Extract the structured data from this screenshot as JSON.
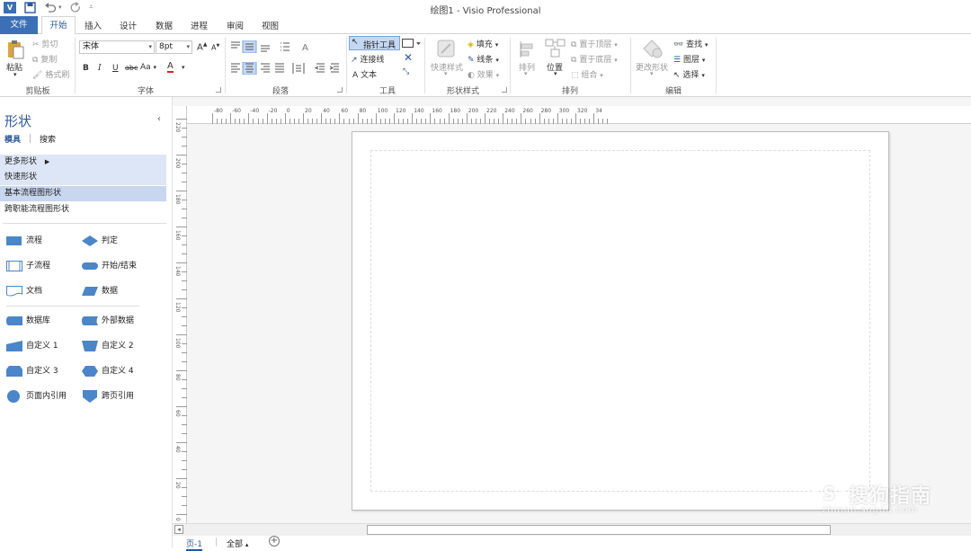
{
  "window": {
    "title": "绘图1 - Visio Professional"
  },
  "qat": {
    "app_icon": "visio-icon",
    "save": "save-icon",
    "undo": "undo-icon",
    "redo": "redo-icon"
  },
  "tabs": {
    "file": "文件",
    "home": "开始",
    "insert": "插入",
    "design": "设计",
    "data": "数据",
    "process": "进程",
    "review": "审阅",
    "view": "视图"
  },
  "ribbon": {
    "clipboard": {
      "label": "剪贴板",
      "paste": "粘贴",
      "cut": "剪切",
      "copy": "复制",
      "format_painter": "格式刷"
    },
    "font": {
      "label": "字体",
      "font_name": "宋体",
      "font_size": "8pt",
      "bold": "B",
      "italic": "I",
      "underline": "U",
      "strike": "abc",
      "case": "Aa",
      "color": "A",
      "grow": "A",
      "shrink": "A"
    },
    "paragraph": {
      "label": "段落"
    },
    "tools": {
      "label": "工具",
      "pointer": "指针工具",
      "connector": "连接线",
      "text": "文本"
    },
    "shape_styles": {
      "label": "形状样式",
      "quick_styles": "快速样式",
      "fill": "填充",
      "line": "线条",
      "effects": "效果"
    },
    "arrange": {
      "label": "排列",
      "align": "排列",
      "position": "位置",
      "bring_front": "置于顶层",
      "send_back": "置于底层",
      "group": "组合"
    },
    "editing": {
      "label": "编辑",
      "change_shape": "更改形状",
      "find": "查找",
      "layers": "图层",
      "select": "选择"
    }
  },
  "panel": {
    "title": "形状",
    "tab_stencils": "模具",
    "tab_search": "搜索",
    "categories": [
      "更多形状",
      "快速形状",
      "基本流程图形状",
      "跨职能流程图形状"
    ],
    "shapes": [
      {
        "label": "流程",
        "icon": "process-shape-icon"
      },
      {
        "label": "判定",
        "icon": "decision-shape-icon"
      },
      {
        "label": "子流程",
        "icon": "subprocess-shape-icon"
      },
      {
        "label": "开始/结束",
        "icon": "start-end-shape-icon"
      },
      {
        "label": "文档",
        "icon": "document-shape-icon"
      },
      {
        "label": "数据",
        "icon": "data-shape-icon"
      },
      {
        "label": "数据库",
        "icon": "database-shape-icon"
      },
      {
        "label": "外部数据",
        "icon": "external-data-shape-icon"
      },
      {
        "label": "自定义 1",
        "icon": "custom1-shape-icon"
      },
      {
        "label": "自定义 2",
        "icon": "custom2-shape-icon"
      },
      {
        "label": "自定义 3",
        "icon": "custom3-shape-icon"
      },
      {
        "label": "自定义 4",
        "icon": "custom4-shape-icon"
      },
      {
        "label": "页面内引用",
        "icon": "on-page-reference-shape-icon"
      },
      {
        "label": "跨页引用",
        "icon": "off-page-reference-shape-icon"
      }
    ]
  },
  "rulers": {
    "horizontal": [
      "-80",
      "-60",
      "-40",
      "-20",
      "0",
      "20",
      "40",
      "60",
      "80",
      "100",
      "120",
      "140",
      "160",
      "180",
      "200",
      "220",
      "240",
      "260",
      "280",
      "300",
      "320",
      "34"
    ],
    "vertical": [
      "220",
      "200",
      "180",
      "160",
      "140",
      "120",
      "100",
      "80",
      "60",
      "40",
      "20",
      "0"
    ]
  },
  "pagebar": {
    "page1": "页-1",
    "all": "全部",
    "add": "+"
  },
  "watermark": {
    "text": "搜狗指南",
    "url": "zhinan.sogou.com"
  },
  "colors": {
    "accent": "#2b579a",
    "file_tab": "#3b6fb6",
    "shape_blue": "#4a86c8",
    "category_highlight": "#c8d6ef"
  }
}
